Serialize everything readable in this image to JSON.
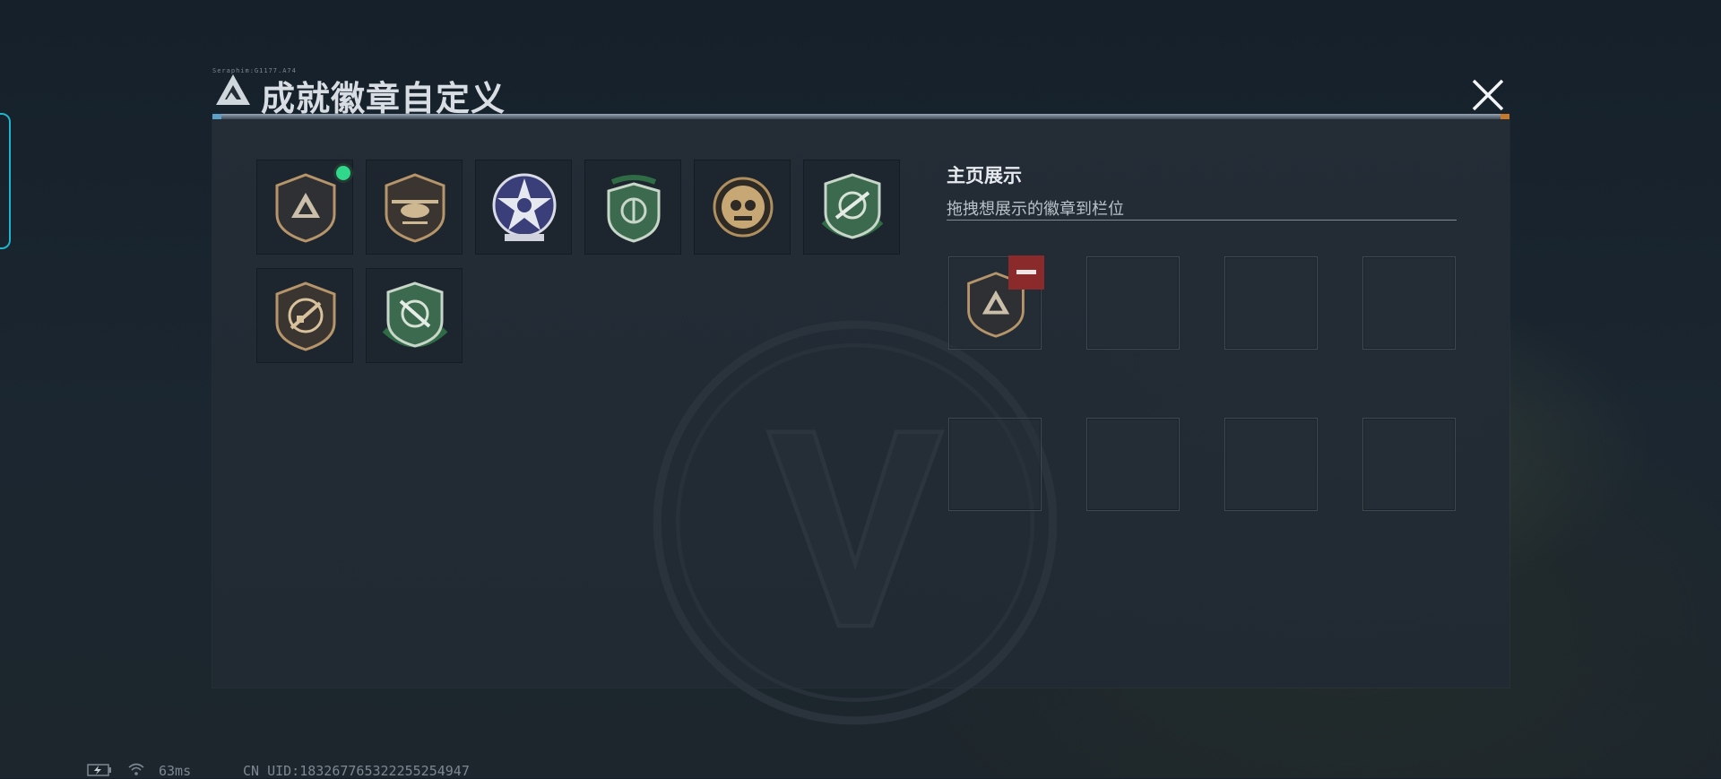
{
  "dialog": {
    "title": "成就徽章自定义",
    "caption": "Seraphim:G1177.A74",
    "close_icon": "close-icon"
  },
  "badges": [
    {
      "icon": "triangle-shield-badge-icon",
      "selected": true
    },
    {
      "icon": "helicopter-shield-badge-icon",
      "selected": false
    },
    {
      "icon": "star-badge-icon",
      "selected": false
    },
    {
      "icon": "green-crest-badge-icon",
      "selected": false
    },
    {
      "icon": "gold-skull-badge-icon",
      "selected": false
    },
    {
      "icon": "green-rifle-crosshair-badge-icon",
      "selected": false
    },
    {
      "icon": "gold-rifle-badge-icon",
      "selected": false
    },
    {
      "icon": "green-knife-crosshair-badge-icon",
      "selected": false
    }
  ],
  "showcase": {
    "title": "主页展示",
    "subtitle": "拖拽想展示的徽章到栏位",
    "slots": [
      {
        "badge": "triangle-shield-badge-icon"
      },
      {
        "badge": null
      },
      {
        "badge": null
      },
      {
        "badge": null
      },
      {
        "badge": null
      },
      {
        "badge": null
      },
      {
        "badge": null
      },
      {
        "badge": null
      }
    ]
  },
  "status": {
    "ping": "63ms",
    "uid": "CN UID:1832677653222552549​47",
    "battery_icon": "battery-charging-icon",
    "wifi_icon": "wifi-icon"
  },
  "colors": {
    "accent_cyan": "#1fb4c9",
    "selected_dot": "#2fd88a",
    "remove_red": "#8a2a2a",
    "badge_gold": "#b6956a",
    "badge_green": "#2f6b45"
  }
}
